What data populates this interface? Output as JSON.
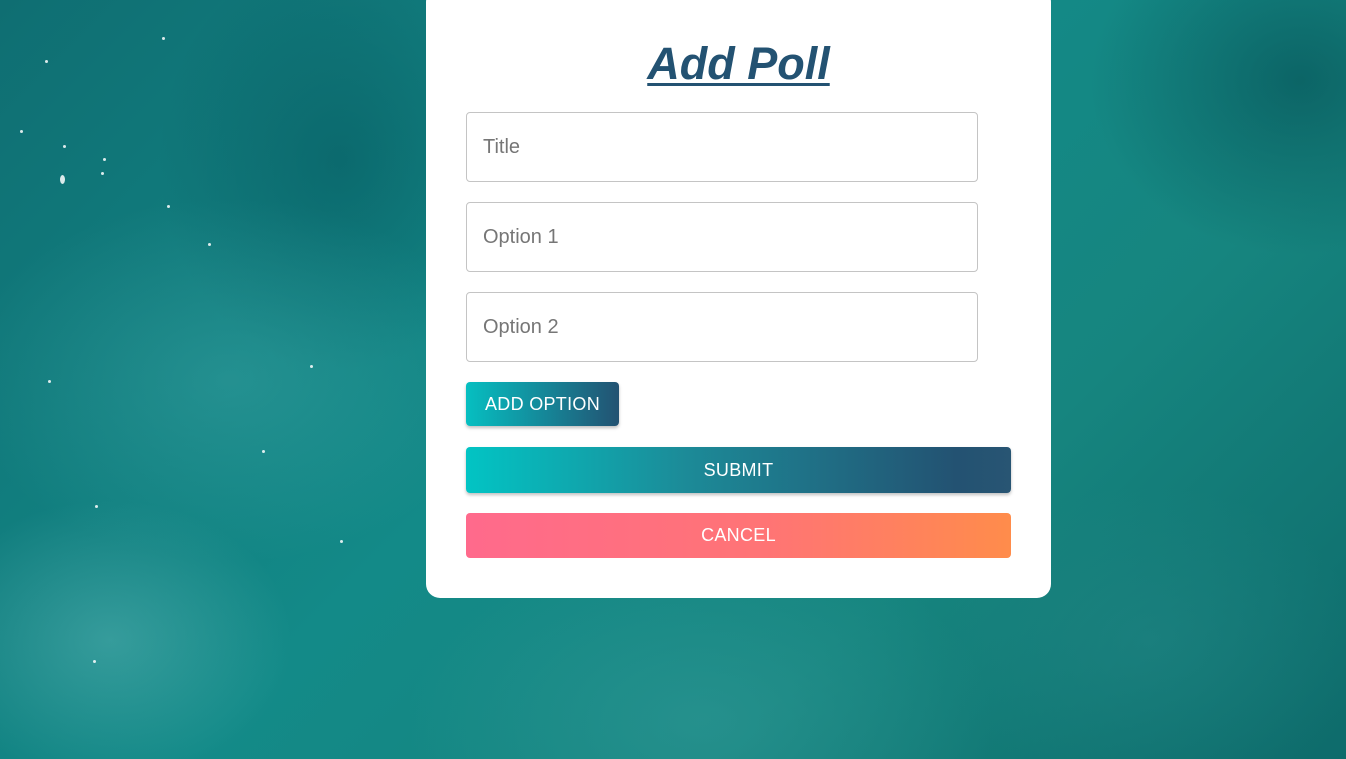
{
  "form": {
    "heading": "Add Poll",
    "title_field": {
      "placeholder": "Title",
      "value": ""
    },
    "option_fields": [
      {
        "placeholder": "Option 1",
        "value": ""
      },
      {
        "placeholder": "Option 2",
        "value": ""
      }
    ],
    "add_option_label": "ADD OPTION",
    "submit_label": "SUBMIT",
    "cancel_label": "CANCEL"
  },
  "colors": {
    "heading": "#235272",
    "gradient_start": "#02c4c4",
    "gradient_end": "#235272",
    "cancel_start": "#ff6a8c",
    "cancel_end": "#ff8c4b"
  }
}
